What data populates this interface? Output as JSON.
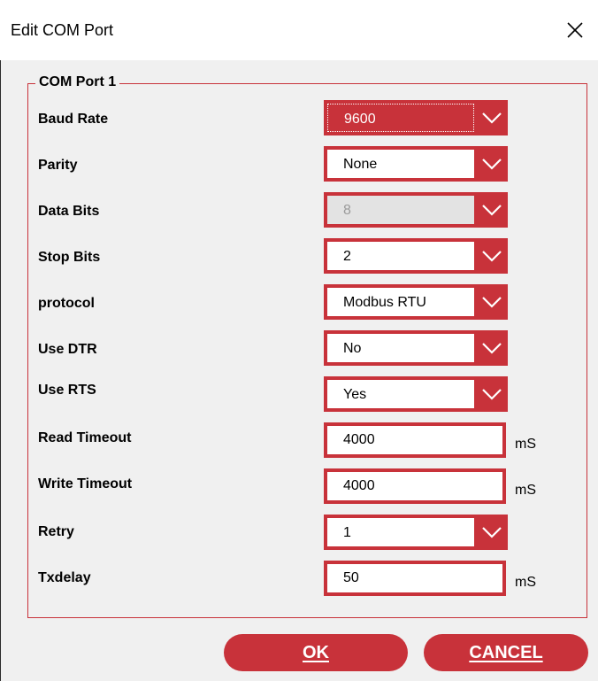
{
  "window": {
    "title": "Edit COM Port",
    "close_icon": "close-icon"
  },
  "group": {
    "label": "COM Port 1"
  },
  "fields": {
    "baud_rate": {
      "label": "Baud Rate",
      "value": "9600"
    },
    "parity": {
      "label": "Parity",
      "value": "None"
    },
    "data_bits": {
      "label": "Data Bits",
      "value": "8"
    },
    "stop_bits": {
      "label": "Stop Bits",
      "value": "2"
    },
    "protocol": {
      "label": "protocol",
      "value": "Modbus RTU"
    },
    "use_dtr": {
      "label": "Use DTR",
      "value": "No"
    },
    "use_rts": {
      "label": "Use RTS",
      "value": "Yes"
    },
    "read_timeout": {
      "label": "Read Timeout",
      "value": "4000",
      "unit": "mS"
    },
    "write_timeout": {
      "label": "Write Timeout",
      "value": "4000",
      "unit": "mS"
    },
    "retry": {
      "label": "Retry",
      "value": "1"
    },
    "txdelay": {
      "label": "Txdelay",
      "value": "50",
      "unit": "mS"
    }
  },
  "buttons": {
    "ok": "OK",
    "cancel": "CANCEL"
  },
  "colors": {
    "accent": "#c8323a",
    "background": "#f0f0f0",
    "disabled_field": "#e3e3e3"
  },
  "icons": {
    "dropdown": "chevron-down-icon"
  }
}
